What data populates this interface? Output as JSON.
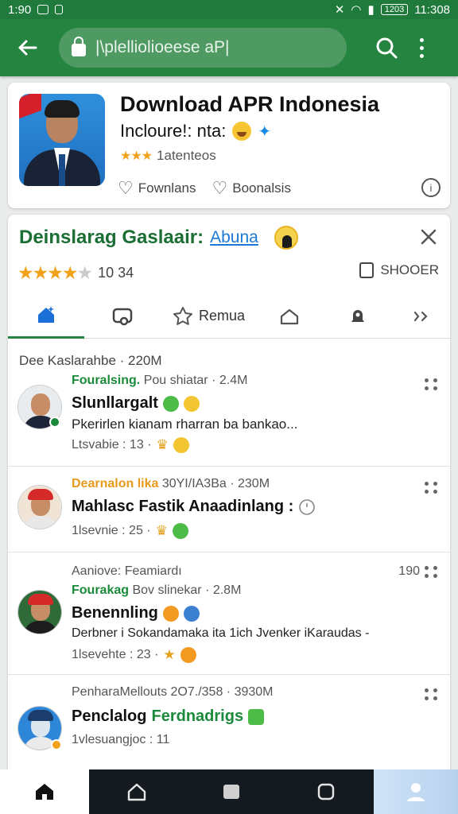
{
  "status_bar": {
    "time_left": "1:90",
    "battery": "1203",
    "time_right": "11:308"
  },
  "app_bar": {
    "url_text": "|\\plelliolioeese aP|",
    "icons": [
      "back-arrow-icon",
      "lock-icon",
      "search-icon",
      "more-vert-icon"
    ]
  },
  "app_card": {
    "title": "Download APR Indonesia",
    "subtitle": "Incloure!: nta:",
    "rating_stars": "★★★",
    "rating_text": "1atenteos",
    "action_1": "Fownlans",
    "action_2": "Boonalsis",
    "info_symbol": "i"
  },
  "feed": {
    "title": "Deinslarag Gaslaair:",
    "link": "Abuna",
    "rating": 4,
    "rating_max": 5,
    "rating_text": "10 34",
    "share_label": "SHOOER",
    "tabs": [
      {
        "label": "",
        "icon": "home-icon"
      },
      {
        "label": "",
        "icon": "chat-icon"
      },
      {
        "label": "Remua",
        "icon": "star-icon"
      },
      {
        "label": "",
        "icon": "house-outline-icon"
      },
      {
        "label": "",
        "icon": "bell-icon"
      },
      {
        "label": "",
        "icon": "chevron-right-icon"
      }
    ],
    "section_label": "Dee Kaslarahbe · 220M",
    "posts": [
      {
        "meta_accent": "Fouralsing.",
        "meta_rest": "Pou shiatar · 2.4M",
        "title": "Slunllargalt",
        "body": "Pkerirlen kianam rharran ba bankao...",
        "stats": "Ltsvabie : 13 ·",
        "count": ""
      },
      {
        "meta_accent": "Dearnalon lika",
        "meta_rest": "30YI/IA3Ba · 230M",
        "title": "Mahlasc Fastik Anaadinlang :",
        "body": "",
        "stats": "1lsevnie : 25 ·",
        "count": ""
      },
      {
        "meta_accent": "Fourakag",
        "meta_rest": "Bov slinekar · 2.8M",
        "meta_top": "Aaniove: Feamiardı",
        "title": "Benennling",
        "body": "Derbner i Sokandamaka ita 1ich Jvenker iKaraudas -",
        "stats": "1lsevehte : 23 ·",
        "count": "190"
      },
      {
        "meta_accent": "",
        "meta_rest": "PenharaMellouts 2O7./358 · 3930M",
        "title": "Penclalog",
        "title_accent": "Ferdnadrigs",
        "body": "",
        "stats": "1vlesuangjoc : 11",
        "count": ""
      }
    ]
  },
  "bottom_nav": {
    "items": [
      "home-icon",
      "home-outline-icon",
      "square-icon",
      "rounded-square-icon",
      "profile-icon"
    ]
  },
  "colors": {
    "app_bar": "#25843f",
    "status_bar": "#1f7a3c",
    "accent_green": "#1b8a3a",
    "star": "#f0a21c",
    "link": "#1a7ad6"
  }
}
